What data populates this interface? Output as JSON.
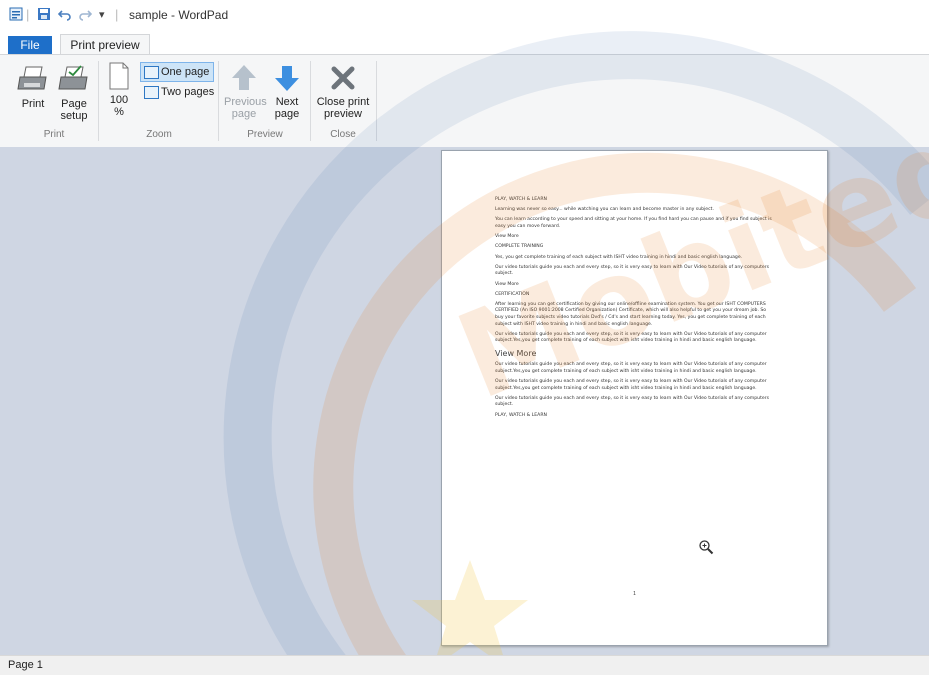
{
  "titlebar": {
    "title": "sample - WordPad",
    "qa_separator": "|",
    "qa_dropdown": "▾"
  },
  "tabs": {
    "file": "File",
    "print_preview": "Print preview"
  },
  "ribbon": {
    "print": {
      "print": "Print",
      "page_setup_line1": "Page",
      "page_setup_line2": "setup",
      "group": "Print"
    },
    "zoom": {
      "zoom_line1": "100",
      "zoom_line2": "%",
      "one_page": "One page",
      "two_pages": "Two pages",
      "group": "Zoom"
    },
    "preview": {
      "previous_line1": "Previous",
      "previous_line2": "page",
      "next_line1": "Next",
      "next_line2": "page",
      "group": "Preview"
    },
    "close": {
      "close_line1": "Close print",
      "close_line2": "preview",
      "group": "Close"
    }
  },
  "document": {
    "paragraphs": [
      "PLAY, WATCH & LEARN",
      "Learning was never so easy... while watching you can learn and become master in any subject.",
      "You can learn according to your speed and sitting at your home. If you find hard you can pause and if you find subject is easy you can move forward.",
      "View More",
      "COMPLETE TRAINING",
      "Yes, you get complete training of each subject with ISHT video training in hindi and basic english language.",
      "Our video tutorials guide you each and every step, so it is very easy to learn with Our Video tutorials of any computers subject.",
      "View More",
      "CERTIFICATION",
      "After learning you can get certification by giving our online/offline examination system. You get our ISHT COMPUTERS CERTIFIED (An ISO 9001:2008 Certified Organization) Certificate, which will also helpful to get you your dream job. So buy your favorite subjects video tutorials Dvd's / Cd's and start learning today. Yes, you get complete training of each subject with ISHT video training in hindi and basic english language.",
      "Our video tutorials guide you each and every step, so it is very easy to learn with Our Video tutorials of any computer subject.Yes,you get complete training of each subject with isht video training in hindi and basic english language.",
      "View More",
      "Our video tutorials guide you each and every step, so it is very easy to learn with Our Video tutorials of any computer subject.Yes,you get complete training of each subject with isht video training in hindi and basic english language.",
      "Our video tutorials guide you each and every step, so it is very easy to learn with Our Video tutorials of any computer subject.Yes,you get complete training of each subject with isht video training in hindi and basic english language.",
      "Our video tutorials guide you each and every step, so it is very easy to learn with Our Video tutorials of any computers subject.",
      "PLAY, WATCH & LEARN"
    ],
    "page_number": "1"
  },
  "watermark": {
    "text": "Mobiteq"
  },
  "statusbar": {
    "page": "Page 1"
  },
  "colors": {
    "file_tab": "#1e6fc9",
    "preview_bg": "#cfd6e3",
    "ribbon_bg": "#f5f6f7",
    "watermark": "#e8852a"
  }
}
